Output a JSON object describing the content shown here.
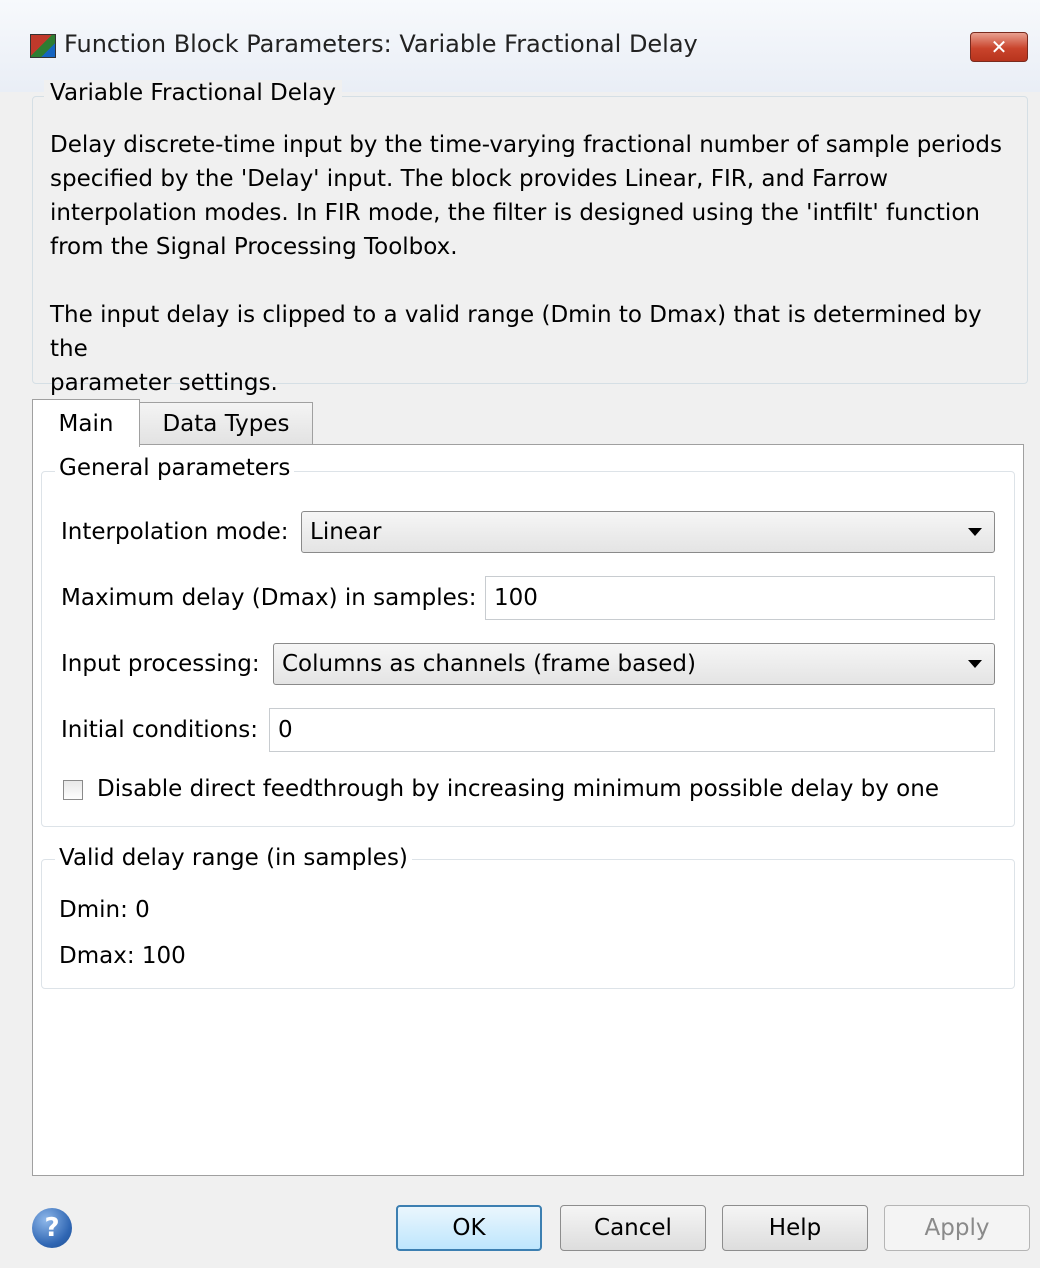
{
  "window": {
    "title": "Function Block Parameters: Variable Fractional Delay",
    "close_glyph": "✕"
  },
  "description": {
    "group_title": "Variable Fractional Delay",
    "paragraph1_lines": [
      "Delay discrete-time input by the time-varying fractional number of sample periods",
      "specified by the 'Delay' input. The block provides Linear, FIR, and Farrow",
      "interpolation modes. In FIR mode, the filter is designed using the 'intfilt' function",
      "from the Signal Processing Toolbox."
    ],
    "paragraph2_lines": [
      "The input delay is clipped to a valid range (Dmin to Dmax) that is determined by the",
      "parameter settings."
    ]
  },
  "tabs": [
    {
      "label": "Main",
      "active": true
    },
    {
      "label": "Data Types",
      "active": false
    }
  ],
  "general": {
    "group_title": "General parameters",
    "interpolation_label": "Interpolation mode:",
    "interpolation_value": "Linear",
    "max_delay_label": "Maximum delay (Dmax) in samples:",
    "max_delay_value": "100",
    "input_processing_label": "Input processing:",
    "input_processing_value": "Columns as channels (frame based)",
    "initial_conditions_label": "Initial conditions:",
    "initial_conditions_value": "0",
    "feedthrough_label": "Disable direct feedthrough by increasing minimum possible delay by one",
    "feedthrough_checked": false
  },
  "valid_range": {
    "group_title": "Valid delay range (in samples)",
    "dmin": "Dmin: 0",
    "dmax": "Dmax: 100"
  },
  "buttons": {
    "ok": "OK",
    "cancel": "Cancel",
    "help": "Help",
    "apply": "Apply",
    "help_icon_glyph": "?"
  }
}
